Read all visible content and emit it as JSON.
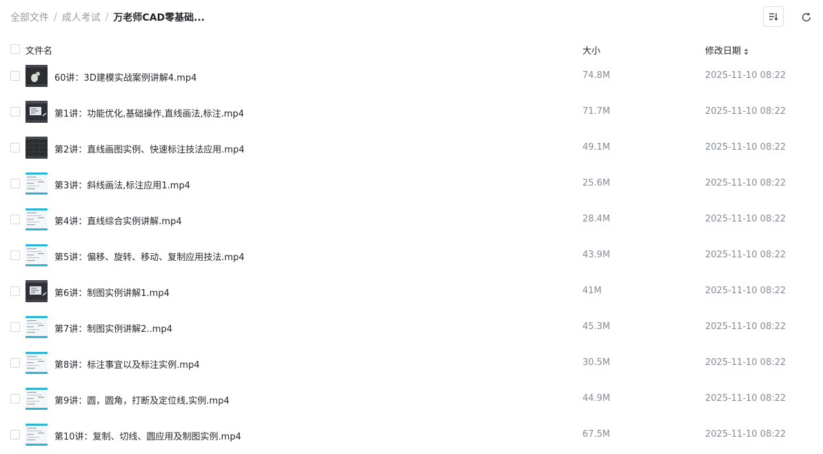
{
  "breadcrumb": {
    "items": [
      "全部文件",
      "成人考试"
    ],
    "separator": "/",
    "current": "万老师CAD零基础..."
  },
  "toolbar": {
    "sort_icon": "sort-list-icon",
    "refresh_icon": "refresh-icon"
  },
  "table": {
    "columns": {
      "name": "文件名",
      "size": "大小",
      "date": "修改日期"
    },
    "rows": [
      {
        "name": "60讲：3D建模实战案例讲解4.mp4",
        "size": "74.8M",
        "date": "2025-11-10 08:22",
        "thumb": "dark"
      },
      {
        "name": "第1讲：功能优化,基础操作,直线画法,标注.mp4",
        "size": "71.7M",
        "date": "2025-11-10 08:22",
        "thumb": "dark-window"
      },
      {
        "name": "第2讲：直线画图实例、快速标注技法应用.mp4",
        "size": "49.1M",
        "date": "2025-11-10 08:22",
        "thumb": "dark-grid"
      },
      {
        "name": "第3讲：斜线画法,标注应用1.mp4",
        "size": "25.6M",
        "date": "2025-11-10 08:22",
        "thumb": "light"
      },
      {
        "name": "第4讲：直线综合实例讲解.mp4",
        "size": "28.4M",
        "date": "2025-11-10 08:22",
        "thumb": "light"
      },
      {
        "name": "第5讲：偏移、旋转、移动、复制应用技法.mp4",
        "size": "43.9M",
        "date": "2025-11-10 08:22",
        "thumb": "light"
      },
      {
        "name": "第6讲：制图实例讲解1.mp4",
        "size": "41M",
        "date": "2025-11-10 08:22",
        "thumb": "dark-window"
      },
      {
        "name": "第7讲：制图实例讲解2..mp4",
        "size": "45.3M",
        "date": "2025-11-10 08:22",
        "thumb": "light"
      },
      {
        "name": "第8讲：标注事宜以及标注实例.mp4",
        "size": "30.5M",
        "date": "2025-11-10 08:22",
        "thumb": "light"
      },
      {
        "name": "第9讲：圆，圆角，打断及定位线,实例.mp4",
        "size": "44.9M",
        "date": "2025-11-10 08:22",
        "thumb": "light"
      },
      {
        "name": "第10讲：复制、切线、圆应用及制图实例.mp4",
        "size": "67.5M",
        "date": "2025-11-10 08:22",
        "thumb": "light"
      }
    ]
  },
  "colors": {
    "breadcrumb_muted": "#999aa3",
    "text_primary": "#25262b",
    "text_secondary": "#878b94",
    "thumb_accent": "#2ab4d8"
  }
}
